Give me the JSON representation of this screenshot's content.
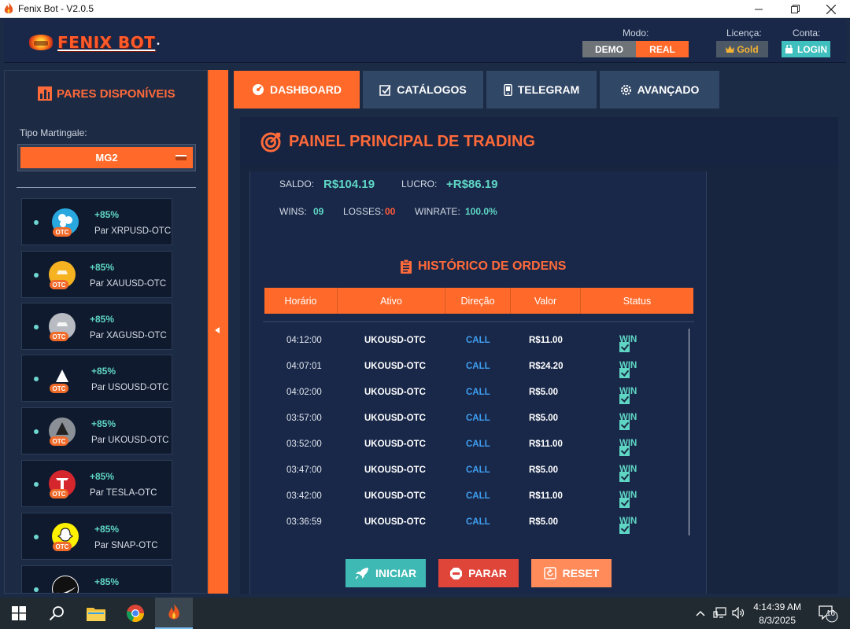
{
  "window": {
    "title": "Fenix Bot - V2.0.5"
  },
  "header": {
    "logo_text": "FENIX BOT",
    "mode_label": "Modo:",
    "mode_demo": "DEMO",
    "mode_real": "REAL",
    "license_label": "Licença:",
    "license_value": "Gold",
    "account_label": "Conta:",
    "login_label": "LOGIN"
  },
  "sidebar": {
    "title": "PARES DISPONÍVEIS",
    "martingale_label": "Tipo Martingale:",
    "martingale_value": "MG2",
    "pairs": [
      {
        "pct": "+85%",
        "name": "Par XRPUSD-OTC",
        "icon": "ripple-icon",
        "color": "#29a8e0"
      },
      {
        "pct": "+85%",
        "name": "Par XAUUSD-OTC",
        "icon": "gold-icon",
        "color": "#f5b321"
      },
      {
        "pct": "+85%",
        "name": "Par XAGUSD-OTC",
        "icon": "silver-icon",
        "color": "#b8bcc2"
      },
      {
        "pct": "+85%",
        "name": "Par USOUSD-OTC",
        "icon": "oil-icon",
        "color": "#1a2230"
      },
      {
        "pct": "+85%",
        "name": "Par UKOUSD-OTC",
        "icon": "brent-oil-icon",
        "color": "#8b8f96"
      },
      {
        "pct": "+85%",
        "name": "Par TESLA-OTC",
        "icon": "tesla-icon",
        "color": "#d5262e"
      },
      {
        "pct": "+85%",
        "name": "Par SNAP-OTC",
        "icon": "snapchat-icon",
        "color": "#fff200"
      },
      {
        "pct": "+85%",
        "name": "",
        "icon": "nike-icon",
        "color": "#111111"
      }
    ]
  },
  "tabs": [
    {
      "label": "DASHBOARD",
      "icon": "gauge-icon"
    },
    {
      "label": "CATÁLOGOS",
      "icon": "checkbox-icon"
    },
    {
      "label": "TELEGRAM",
      "icon": "phone-icon"
    },
    {
      "label": "AVANÇADO",
      "icon": "gear-icon"
    }
  ],
  "panel": {
    "title": "PAINEL PRINCIPAL DE TRADING"
  },
  "stats": {
    "saldo_label": "SALDO:",
    "saldo": "R$104.19",
    "lucro_label": "LUCRO:",
    "lucro": "+R$86.19",
    "wins_label": "WINS:",
    "wins": "09",
    "losses_label": "LOSSES:",
    "losses": "00",
    "winrate_label": "WINRATE:",
    "winrate": "100.0%"
  },
  "history": {
    "title": "HISTÓRICO DE ORDENS",
    "columns": [
      "Horário",
      "Ativo",
      "Direção",
      "Valor",
      "Status"
    ],
    "rows": [
      {
        "time": "04:12:00",
        "asset": "UKOUSD-OTC",
        "direction": "CALL",
        "value": "R$11.00",
        "status": "WIN"
      },
      {
        "time": "04:07:01",
        "asset": "UKOUSD-OTC",
        "direction": "CALL",
        "value": "R$24.20",
        "status": "WIN"
      },
      {
        "time": "04:02:00",
        "asset": "UKOUSD-OTC",
        "direction": "CALL",
        "value": "R$5.00",
        "status": "WIN"
      },
      {
        "time": "03:57:00",
        "asset": "UKOUSD-OTC",
        "direction": "CALL",
        "value": "R$5.00",
        "status": "WIN"
      },
      {
        "time": "03:52:00",
        "asset": "UKOUSD-OTC",
        "direction": "CALL",
        "value": "R$11.00",
        "status": "WIN"
      },
      {
        "time": "03:47:00",
        "asset": "UKOUSD-OTC",
        "direction": "CALL",
        "value": "R$5.00",
        "status": "WIN"
      },
      {
        "time": "03:42:00",
        "asset": "UKOUSD-OTC",
        "direction": "CALL",
        "value": "R$11.00",
        "status": "WIN"
      },
      {
        "time": "03:36:59",
        "asset": "UKOUSD-OTC",
        "direction": "CALL",
        "value": "R$5.00",
        "status": "WIN"
      }
    ]
  },
  "actions": {
    "start": "INICIAR",
    "stop": "PARAR",
    "reset": "RESET"
  },
  "colors": {
    "accent": "#ff6a2a",
    "teal": "#5fd6c4",
    "call_blue": "#3f9ef0",
    "stop_red": "#e0453a",
    "reset_orange": "#ff8a5a"
  },
  "taskbar": {
    "time": "4:14:39 AM",
    "date": "8/3/2025",
    "notifications": "16"
  }
}
